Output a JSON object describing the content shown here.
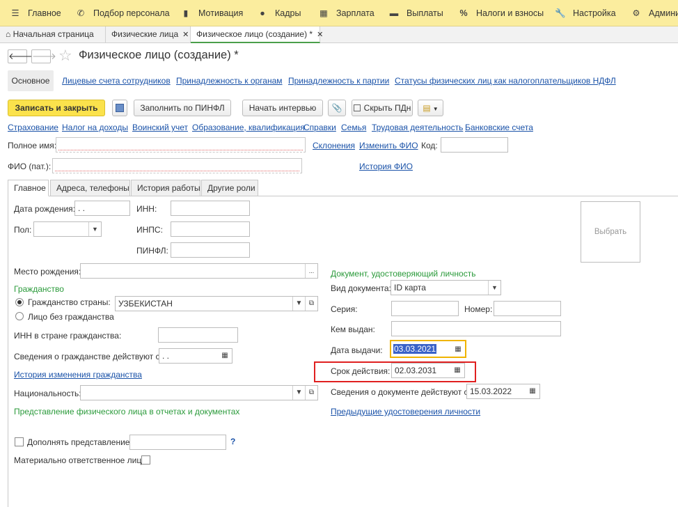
{
  "menu": [
    {
      "icon": "hamburger-icon",
      "label": "Главное"
    },
    {
      "icon": "phone-icon",
      "label": "Подбор персонала"
    },
    {
      "icon": "dumbbell-icon",
      "label": "Мотивация"
    },
    {
      "icon": "people-icon",
      "label": "Кадры"
    },
    {
      "icon": "calculator-icon",
      "label": "Зарплата"
    },
    {
      "icon": "wallet-icon",
      "label": "Выплаты"
    },
    {
      "icon": "percent-icon",
      "label": "Налоги и взносы"
    },
    {
      "icon": "wrench-icon",
      "label": "Настройка"
    },
    {
      "icon": "gear-icon",
      "label": "Админи"
    }
  ],
  "page_tabs": [
    {
      "label": "Начальная страница"
    },
    {
      "label": "Физические лица",
      "close": "✕"
    },
    {
      "label": "Физическое лицо (создание) *",
      "close": "✕"
    }
  ],
  "title": "Физическое лицо (создание) *",
  "sections": {
    "main": "Основное",
    "links": [
      "Лицевые счета сотрудников",
      "Принадлежность к органам",
      "Принадлежность к партии",
      "Статусы физических лиц как налогоплательщиков НДФЛ"
    ]
  },
  "toolbar": {
    "save_close": "Записать и закрыть",
    "fill_pinfl": "Заполнить по ПИНФЛ",
    "start_interview": "Начать интервью",
    "hide_pd": "Скрыть ПДн"
  },
  "subsections": [
    "Страхование",
    "Налог на доходы",
    "Воинский учет",
    "Образование, квалификация",
    "Справки",
    "Семья",
    "Трудовая деятельность",
    "Банковские счета"
  ],
  "header_fields": {
    "full_name_label": "Полное имя:",
    "full_name_value": "",
    "declensions_link": "Склонения",
    "change_fio_link": "Изменить ФИО",
    "code_label": "Код:",
    "code_value": "",
    "fio_lat_label": "ФИО (пат.):",
    "fio_lat_value": "",
    "fio_history_link": "История ФИО"
  },
  "inner_tabs": [
    "Главное",
    "Адреса, телефоны",
    "История работы",
    "Другие роли"
  ],
  "main_tab": {
    "birth_date_label": "Дата рождения:",
    "birth_date_value": " .  .",
    "inn_label": "ИНН:",
    "gender_label": "Пол:",
    "inps_label": "ИНПС:",
    "pinfl_label": "ПИНФЛ:",
    "photo_label": "Выбрать",
    "birthplace_label": "Место рождения:",
    "ellipsis": "...",
    "citizenship_header": "Гражданство",
    "citizenship_country_label": "Гражданство страны:",
    "citizenship_country_value": "УЗБЕКИСТАН",
    "stateless_label": "Лицо без гражданства",
    "inn_foreign_label": "ИНН в стране гражданства:",
    "citizenship_from_label": "Сведения о гражданстве действуют с:",
    "citizenship_from_value": " .  .",
    "citizenship_history_link": "История изменения гражданства",
    "nationality_label": "Национальность:",
    "representation_header": "Представление физического лица в отчетах и документах",
    "supplement_label": "Дополнять представление",
    "help": "?",
    "liable_label": "Материально ответственное лицо:"
  },
  "id_document": {
    "header": "Документ, удостоверяющий личность",
    "type_label": "Вид документа:",
    "type_value": "ID карта",
    "series_label": "Серия:",
    "number_label": "Номер:",
    "issued_by_label": "Кем выдан:",
    "issue_date_label": "Дата выдачи:",
    "issue_date_value": "03.03.2021",
    "valid_until_label": "Срок действия:",
    "valid_until_value": "02.03.2031",
    "effective_from_label": "Сведения о документе действуют с:",
    "effective_from_value": "15.03.2022",
    "previous_link": "Предыдущие удостоверения личности"
  },
  "colors": {
    "menu_bg": "#fbed9e",
    "primary_button": "#fbe24c",
    "link": "#1a52a8",
    "green_header": "#2a9a3a",
    "highlight_box": "#e02020",
    "focus_border": "#f0b400"
  }
}
